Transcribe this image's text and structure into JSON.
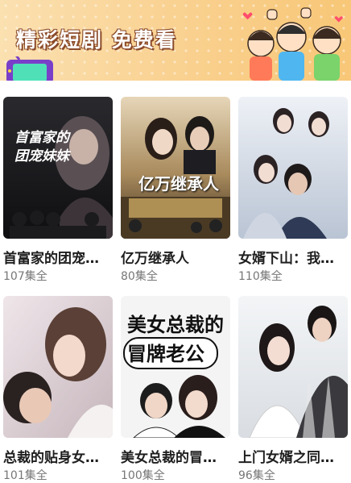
{
  "banner": {
    "title": "精彩短剧 免费看"
  },
  "dramas": [
    {
      "title": "首富家的团宠…",
      "count": "107集全",
      "poster_text": "首富家的团宠妹妹"
    },
    {
      "title": "亿万继承人",
      "count": "80集全",
      "poster_text": "亿万继承人"
    },
    {
      "title": "女婿下山：我…",
      "count": "110集全",
      "poster_text": ""
    },
    {
      "title": "总裁的贴身女…",
      "count": "101集全",
      "poster_text": ""
    },
    {
      "title": "美女总裁的冒…",
      "count": "100集全",
      "poster_text": "美女总裁的冒牌老公"
    },
    {
      "title": "上门女婿之同…",
      "count": "96集全",
      "poster_text": ""
    }
  ],
  "colors": {
    "banner_start": "#fbe0b0",
    "banner_end": "#f8c777",
    "title_text": "#1e1e1e",
    "count_text": "#777777"
  }
}
